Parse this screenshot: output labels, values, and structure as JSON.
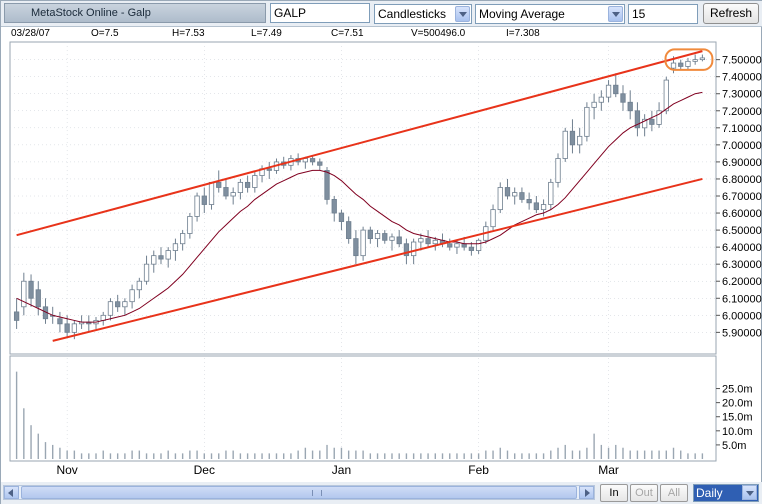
{
  "toolbar": {
    "app_title": "MetaStock Online - Galp",
    "symbol": "GALP",
    "chart_type": "Candlesticks",
    "indicator": "Moving Average",
    "period": "15",
    "refresh_label": "Refresh"
  },
  "info": {
    "date": "03/28/07",
    "open": "O=7.5",
    "high": "H=7.53",
    "low": "L=7.49",
    "close": "C=7.51",
    "volume": "V=500496.0",
    "indicator_value": "I=7.308"
  },
  "colors": {
    "up_candle": "#ffffff",
    "down_candle": "#7f8f9f",
    "candle_outline": "#6f7f8f",
    "trendline": "#e8331a",
    "moving_average": "#800020",
    "highlight": "#f08a3c",
    "volume_bar": "#9aa6b2",
    "grid": "#c8ced6"
  },
  "chart_data": {
    "type": "candlestick",
    "price_axis_ticks": [
      "7.50000",
      "7.40000",
      "7.30000",
      "7.20000",
      "7.10000",
      "7.00000",
      "6.90000",
      "6.80000",
      "6.70000",
      "6.60000",
      "6.50000",
      "6.40000",
      "6.30000",
      "6.20000",
      "6.10000",
      "6.00000",
      "5.90000"
    ],
    "volume_axis_ticks": [
      "25.0m",
      "20.0m",
      "15.0m",
      "10.0m",
      "5.0m"
    ],
    "month_labels": [
      "Nov",
      "Dec",
      "Jan",
      "Feb",
      "Mar"
    ],
    "ylim": [
      5.82,
      7.58
    ],
    "volume_ylim": [
      0,
      33
    ],
    "candles": [
      [
        6.02,
        6.1,
        5.92,
        5.97
      ],
      [
        6.05,
        6.25,
        6.0,
        6.2
      ],
      [
        6.2,
        6.24,
        6.05,
        6.1
      ],
      [
        6.15,
        6.2,
        6.0,
        6.05
      ],
      [
        6.05,
        6.1,
        5.95,
        5.98
      ],
      [
        6.0,
        6.05,
        5.95,
        6.0
      ],
      [
        5.98,
        6.02,
        5.9,
        5.95
      ],
      [
        5.95,
        6.0,
        5.87,
        5.9
      ],
      [
        5.9,
        5.97,
        5.86,
        5.95
      ],
      [
        5.95,
        6.0,
        5.92,
        5.96
      ],
      [
        5.96,
        6.0,
        5.9,
        5.95
      ],
      [
        5.95,
        5.99,
        5.92,
        5.97
      ],
      [
        5.97,
        6.02,
        5.94,
        6.0
      ],
      [
        6.0,
        6.1,
        5.97,
        6.08
      ],
      [
        6.08,
        6.12,
        6.02,
        6.05
      ],
      [
        6.05,
        6.1,
        6.0,
        6.08
      ],
      [
        6.08,
        6.18,
        6.04,
        6.15
      ],
      [
        6.15,
        6.22,
        6.1,
        6.2
      ],
      [
        6.2,
        6.35,
        6.18,
        6.3
      ],
      [
        6.3,
        6.38,
        6.25,
        6.35
      ],
      [
        6.35,
        6.4,
        6.3,
        6.33
      ],
      [
        6.33,
        6.4,
        6.28,
        6.38
      ],
      [
        6.38,
        6.45,
        6.32,
        6.42
      ],
      [
        6.42,
        6.5,
        6.38,
        6.48
      ],
      [
        6.48,
        6.6,
        6.45,
        6.58
      ],
      [
        6.58,
        6.72,
        6.55,
        6.7
      ],
      [
        6.7,
        6.75,
        6.6,
        6.65
      ],
      [
        6.65,
        6.78,
        6.62,
        6.78
      ],
      [
        6.78,
        6.85,
        6.72,
        6.75
      ],
      [
        6.75,
        6.8,
        6.68,
        6.7
      ],
      [
        6.7,
        6.75,
        6.65,
        6.72
      ],
      [
        6.72,
        6.8,
        6.68,
        6.78
      ],
      [
        6.78,
        6.82,
        6.72,
        6.75
      ],
      [
        6.75,
        6.85,
        6.72,
        6.82
      ],
      [
        6.82,
        6.88,
        6.78,
        6.86
      ],
      [
        6.86,
        6.9,
        6.8,
        6.85
      ],
      [
        6.85,
        6.92,
        6.83,
        6.9
      ],
      [
        6.9,
        6.93,
        6.86,
        6.88
      ],
      [
        6.88,
        6.94,
        6.85,
        6.92
      ],
      [
        6.92,
        6.95,
        6.88,
        6.9
      ],
      [
        6.9,
        6.93,
        6.86,
        6.92
      ],
      [
        6.92,
        6.94,
        6.88,
        6.9
      ],
      [
        6.9,
        6.92,
        6.85,
        6.88
      ],
      [
        6.85,
        6.87,
        6.65,
        6.68
      ],
      [
        6.68,
        6.7,
        6.55,
        6.6
      ],
      [
        6.6,
        6.62,
        6.5,
        6.55
      ],
      [
        6.55,
        6.58,
        6.42,
        6.45
      ],
      [
        6.45,
        6.5,
        6.3,
        6.35
      ],
      [
        6.35,
        6.52,
        6.32,
        6.5
      ],
      [
        6.5,
        6.52,
        6.42,
        6.45
      ],
      [
        6.45,
        6.5,
        6.4,
        6.48
      ],
      [
        6.48,
        6.5,
        6.42,
        6.44
      ],
      [
        6.44,
        6.48,
        6.38,
        6.46
      ],
      [
        6.46,
        6.5,
        6.4,
        6.42
      ],
      [
        6.42,
        6.45,
        6.3,
        6.35
      ],
      [
        6.35,
        6.45,
        6.3,
        6.43
      ],
      [
        6.43,
        6.48,
        6.38,
        6.45
      ],
      [
        6.45,
        6.5,
        6.4,
        6.42
      ],
      [
        6.42,
        6.46,
        6.38,
        6.44
      ],
      [
        6.44,
        6.48,
        6.4,
        6.42
      ],
      [
        6.42,
        6.45,
        6.38,
        6.4
      ],
      [
        6.4,
        6.44,
        6.36,
        6.42
      ],
      [
        6.42,
        6.46,
        6.38,
        6.4
      ],
      [
        6.4,
        6.43,
        6.35,
        6.38
      ],
      [
        6.38,
        6.45,
        6.36,
        6.44
      ],
      [
        6.44,
        6.55,
        6.42,
        6.52
      ],
      [
        6.52,
        6.65,
        6.5,
        6.62
      ],
      [
        6.62,
        6.78,
        6.6,
        6.75
      ],
      [
        6.75,
        6.8,
        6.68,
        6.7
      ],
      [
        6.7,
        6.75,
        6.65,
        6.72
      ],
      [
        6.72,
        6.75,
        6.66,
        6.68
      ],
      [
        6.68,
        6.72,
        6.62,
        6.66
      ],
      [
        6.66,
        6.7,
        6.6,
        6.62
      ],
      [
        6.62,
        6.68,
        6.58,
        6.65
      ],
      [
        6.65,
        6.8,
        6.62,
        6.78
      ],
      [
        6.78,
        6.95,
        6.75,
        6.92
      ],
      [
        6.92,
        7.1,
        6.9,
        7.08
      ],
      [
        7.08,
        7.15,
        6.95,
        7.0
      ],
      [
        7.0,
        7.1,
        6.95,
        7.05
      ],
      [
        7.05,
        7.25,
        7.02,
        7.22
      ],
      [
        7.22,
        7.3,
        7.15,
        7.25
      ],
      [
        7.25,
        7.32,
        7.2,
        7.28
      ],
      [
        7.28,
        7.38,
        7.25,
        7.35
      ],
      [
        7.35,
        7.42,
        7.28,
        7.3
      ],
      [
        7.3,
        7.35,
        7.2,
        7.25
      ],
      [
        7.25,
        7.32,
        7.15,
        7.2
      ],
      [
        7.2,
        7.25,
        7.05,
        7.1
      ],
      [
        7.1,
        7.18,
        7.05,
        7.15
      ],
      [
        7.15,
        7.2,
        7.08,
        7.12
      ],
      [
        7.12,
        7.25,
        7.1,
        7.2
      ],
      [
        7.2,
        7.4,
        7.18,
        7.38
      ],
      [
        7.45,
        7.52,
        7.42,
        7.48
      ],
      [
        7.48,
        7.5,
        7.44,
        7.46
      ],
      [
        7.46,
        7.51,
        7.44,
        7.49
      ],
      [
        7.49,
        7.53,
        7.47,
        7.5
      ],
      [
        7.5,
        7.53,
        7.49,
        7.51
      ]
    ],
    "moving_average": [
      6.1,
      6.08,
      6.06,
      6.04,
      6.02,
      6.0,
      5.99,
      5.98,
      5.97,
      5.96,
      5.96,
      5.96,
      5.97,
      5.98,
      5.99,
      6.0,
      6.02,
      6.04,
      6.07,
      6.1,
      6.13,
      6.16,
      6.2,
      6.24,
      6.29,
      6.34,
      6.39,
      6.44,
      6.49,
      6.53,
      6.57,
      6.61,
      6.64,
      6.68,
      6.71,
      6.74,
      6.77,
      6.79,
      6.81,
      6.83,
      6.84,
      6.85,
      6.85,
      6.84,
      6.82,
      6.79,
      6.75,
      6.71,
      6.68,
      6.64,
      6.61,
      6.58,
      6.55,
      6.53,
      6.5,
      6.48,
      6.47,
      6.46,
      6.45,
      6.44,
      6.43,
      6.43,
      6.42,
      6.42,
      6.42,
      6.43,
      6.45,
      6.47,
      6.5,
      6.53,
      6.55,
      6.57,
      6.59,
      6.6,
      6.62,
      6.65,
      6.69,
      6.74,
      6.79,
      6.84,
      6.89,
      6.94,
      6.99,
      7.03,
      7.07,
      7.1,
      7.12,
      7.14,
      7.16,
      7.18,
      7.21,
      7.24,
      7.26,
      7.28,
      7.3,
      7.308
    ],
    "volume": [
      31,
      18,
      12,
      9,
      6,
      5,
      4,
      3,
      3,
      2,
      2,
      2,
      3,
      2,
      2,
      2,
      3,
      3,
      2,
      2,
      2,
      3,
      2,
      2,
      3,
      3,
      2,
      2,
      2,
      3,
      3,
      2,
      2,
      2,
      2,
      2,
      2,
      2,
      2,
      3,
      4,
      3,
      3,
      5,
      4,
      4,
      3,
      3,
      3,
      2,
      2,
      2,
      2,
      2,
      2,
      2,
      2,
      2,
      2,
      2,
      2,
      2,
      2,
      2,
      2,
      3,
      3,
      4,
      3,
      2,
      2,
      2,
      2,
      2,
      3,
      4,
      5,
      3,
      3,
      4,
      9,
      5,
      4,
      5,
      4,
      3,
      3,
      3,
      3,
      3,
      3,
      4,
      3,
      2,
      2,
      2
    ],
    "upper_channel": [
      [
        0,
        6.47
      ],
      [
        95,
        7.55
      ]
    ],
    "lower_channel": [
      [
        5,
        5.85
      ],
      [
        95,
        6.8
      ]
    ]
  },
  "statusbar": {
    "zoom_in": "In",
    "zoom_out": "Out",
    "zoom_all": "All",
    "interval": "Daily"
  }
}
